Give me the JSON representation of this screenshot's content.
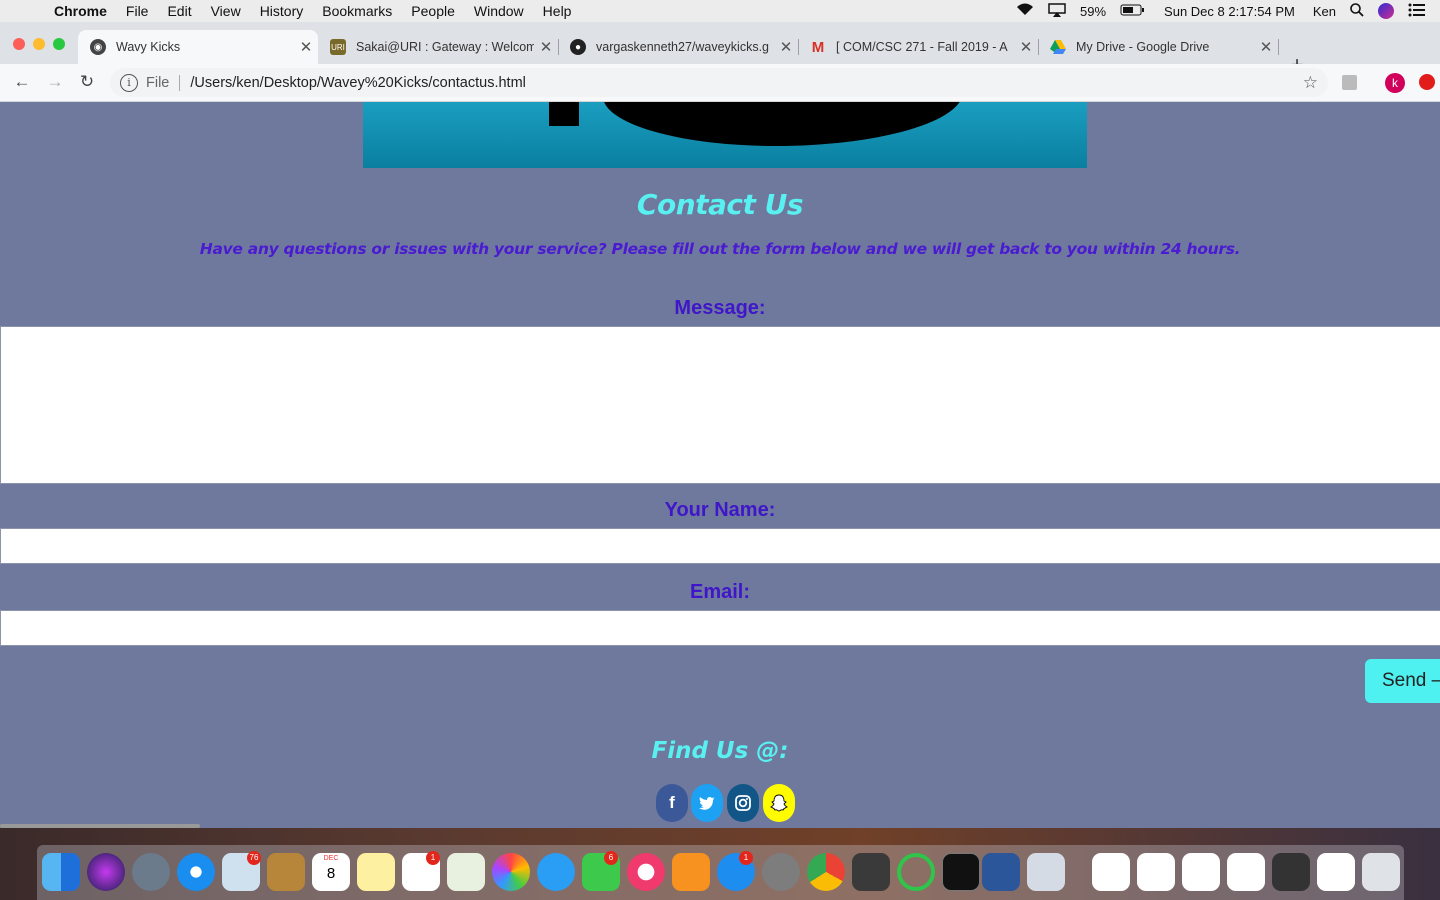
{
  "menubar": {
    "app": "Chrome",
    "items": [
      "File",
      "Edit",
      "View",
      "History",
      "Bookmarks",
      "People",
      "Window",
      "Help"
    ],
    "battery": "59%",
    "clock": "Sun Dec 8  2:17:54 PM",
    "user": "Ken"
  },
  "tabs": [
    {
      "title": "Wavy Kicks",
      "icon": "globe-icon"
    },
    {
      "title": "Sakai@URI : Gateway : Welcom",
      "icon": "uri-icon"
    },
    {
      "title": "vargaskenneth27/waveykicks.g",
      "icon": "github-icon"
    },
    {
      "title": "[ COM/CSC 271 - Fall 2019 - A",
      "icon": "gmail-icon"
    },
    {
      "title": "My Drive - Google Drive",
      "icon": "drive-icon"
    }
  ],
  "address": {
    "scheme": "File",
    "url": "/Users/ken/Desktop/Wavey%20Kicks/contactus.html"
  },
  "profile_initial": "k",
  "page": {
    "title": "Contact Us",
    "subtitle": "Have any questions or issues with your service? Please fill out the form below and we will get back to you within 24 hours.",
    "message_label": "Message:",
    "name_label": "Your Name:",
    "email_label": "Email:",
    "send_label": "Send –",
    "find_us": "Find Us @:",
    "social": [
      {
        "icon": "facebook-icon",
        "glyph": "f",
        "color": "#3b5998"
      },
      {
        "icon": "twitter-icon",
        "glyph": "t",
        "color": "#1da1f2"
      },
      {
        "icon": "instagram-icon",
        "glyph": "◎",
        "color": "#125688"
      },
      {
        "icon": "snapchat-icon",
        "glyph": "☻",
        "color": "#fffc00"
      }
    ]
  },
  "dock": {
    "badges": [
      "76",
      "1",
      "6",
      "1"
    ],
    "calendar_month": "DEC",
    "calendar_day": "8"
  }
}
